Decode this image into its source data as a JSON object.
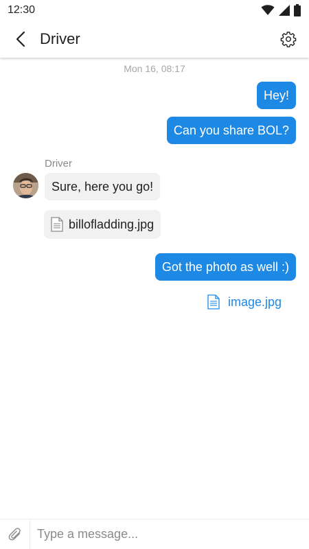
{
  "status_bar": {
    "time": "12:30",
    "icons": [
      "wifi-icon",
      "signal-icon",
      "battery-icon"
    ]
  },
  "header": {
    "title": "Driver",
    "back_icon": "chevron-left-icon",
    "settings_icon": "gear-icon"
  },
  "conversation": {
    "timestamp": "Mon 16, 08:17",
    "messages": [
      {
        "direction": "outgoing",
        "text": "Hey!"
      },
      {
        "direction": "outgoing",
        "text": "Can you share BOL?"
      },
      {
        "direction": "incoming",
        "sender": "Driver",
        "text": "Sure, here you go!"
      },
      {
        "direction": "incoming",
        "type": "file",
        "file_name": "billofladding.jpg"
      },
      {
        "direction": "outgoing",
        "text": "Got the photo as well :)"
      },
      {
        "direction": "outgoing",
        "type": "file",
        "file_name": "image.jpg"
      }
    ]
  },
  "composer": {
    "attach_icon": "paperclip-icon",
    "placeholder": "Type a message..."
  },
  "colors": {
    "accent": "#1e88e5",
    "incoming_bubble": "#f1f1f1",
    "timestamp": "#a6a6a6",
    "sender_name": "#8a8a8a"
  }
}
